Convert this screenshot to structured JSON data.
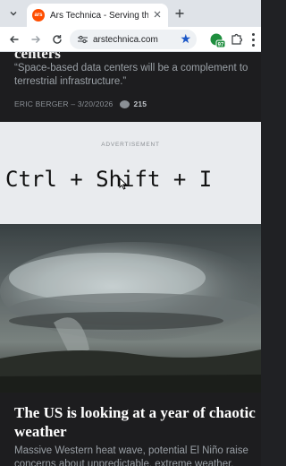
{
  "browser": {
    "tab": {
      "title": "Ars Technica - Serving the Technologist",
      "favicon_text": "ars"
    },
    "url": "arstechnica.com",
    "extension_badge_count": "97",
    "icons": {
      "tab_menu": "chevron-down-icon",
      "close": "close-icon",
      "new_tab": "plus-icon",
      "back": "arrow-left-icon",
      "forward": "arrow-right-icon",
      "reload": "reload-icon",
      "site_info": "tune-icon",
      "bookmark": "star-icon",
      "extensions": "puzzle-icon",
      "menu": "kebab-menu-icon"
    }
  },
  "article_top": {
    "headline_fragment": "centers",
    "quote": "“Space-based data centers will be a complement to terrestrial infrastructure.”",
    "byline": "ERIC BERGER – 3/20/2026",
    "comment_count": "215"
  },
  "advertisement": {
    "label": "ADVERTISEMENT",
    "shortcut_text": "Ctrl + Shift + I"
  },
  "feature": {
    "image": "supercell-storm-photo",
    "headline": "The US is looking at a year of chaotic weather",
    "dek": "Massive Western heat wave, potential El Niño raise concerns about unpredictable, extreme weather."
  },
  "colors": {
    "page_background": "#1d1d1f",
    "ad_background": "#e9ebee",
    "accent_star": "#1a56c7",
    "ars_orange": "#ff4e00"
  }
}
